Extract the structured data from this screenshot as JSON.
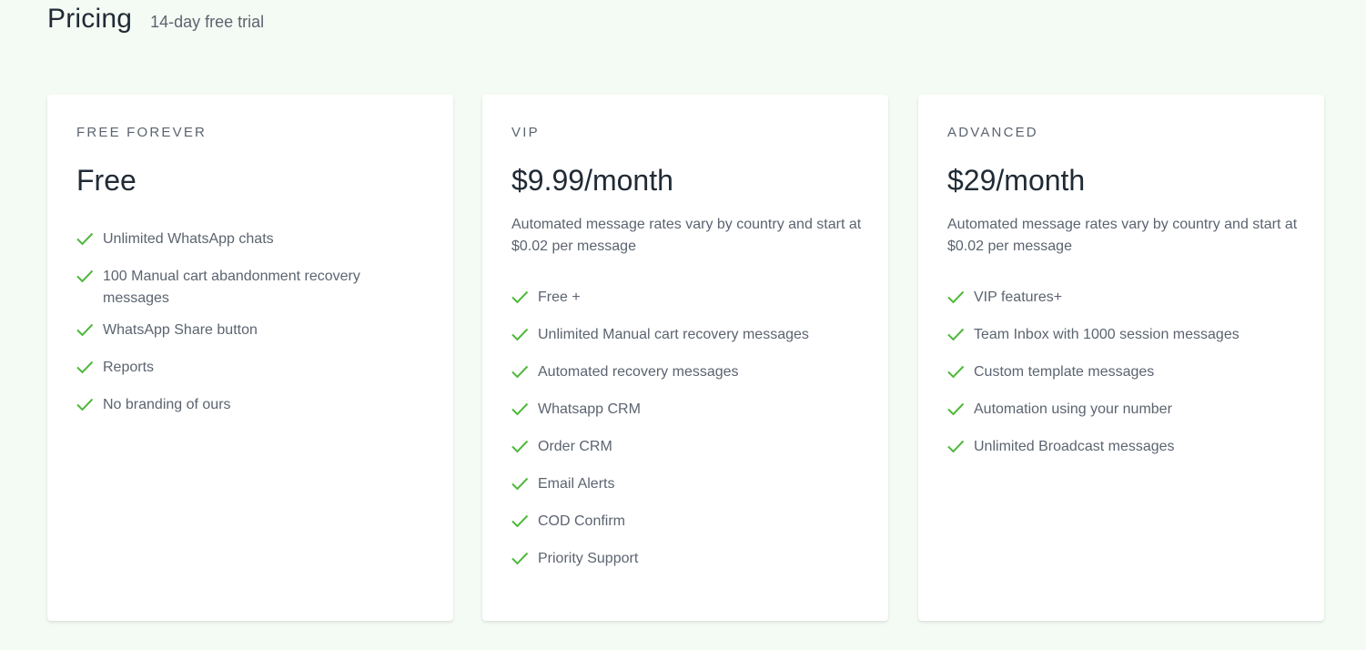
{
  "header": {
    "title": "Pricing",
    "subtitle": "14-day free trial"
  },
  "colors": {
    "background": "#f4fbf4",
    "check": "#50b83c",
    "text_muted": "#5c6470",
    "text_dark": "#212b36"
  },
  "plans": [
    {
      "tier": "FREE FOREVER",
      "price": "Free",
      "features": [
        "Unlimited WhatsApp chats",
        "100 Manual cart abandonment recovery messages",
        "WhatsApp Share button",
        "Reports",
        "No branding of ours"
      ]
    },
    {
      "tier": "VIP",
      "price": "$9.99/month",
      "note": "Automated message rates vary by country and start at $0.02 per message",
      "features": [
        "Free +",
        "Unlimited Manual cart recovery messages",
        "Automated recovery messages",
        "Whatsapp CRM",
        "Order CRM",
        "Email Alerts",
        "COD Confirm",
        "Priority Support"
      ]
    },
    {
      "tier": "ADVANCED",
      "price": "$29/month",
      "note": "Automated message rates vary by country and start at $0.02 per message",
      "features": [
        "VIP features+",
        "Team Inbox with 1000 session messages",
        "Custom template messages",
        "Automation using your number",
        "Unlimited Broadcast messages"
      ]
    }
  ],
  "icons": {
    "feature_check": "check-icon"
  }
}
